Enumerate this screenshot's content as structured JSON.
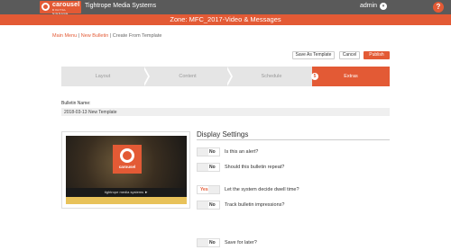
{
  "header": {
    "logo_text": "carousel",
    "logo_sub": "DIGITAL SIGNAGE",
    "org_name": "Tightrope Media Systems",
    "user": "admin",
    "user_caret_icon": "chevron-down-icon",
    "help_icon": "?"
  },
  "zone": {
    "title": "Zone: MFC_2017-Video & Messages"
  },
  "breadcrumb": {
    "main_menu": "Main Menu",
    "sep1": " | ",
    "new_bulletin": "New Bulletin",
    "sep2": " | ",
    "current": "Create From Template"
  },
  "toolbar": {
    "save_template": "Save As Template",
    "cancel": "Cancel",
    "publish": "Publish"
  },
  "steps": [
    {
      "label": "Layout"
    },
    {
      "label": "Content"
    },
    {
      "label": "Schedule"
    },
    {
      "label": "Extras",
      "active": true,
      "number": "5"
    }
  ],
  "bulletin": {
    "name_label": "Bulletin Name:",
    "name_value": "2018-03-13 New Template"
  },
  "preview": {
    "logo_text": "carousel",
    "caption": "tightrope media systems ►"
  },
  "display_settings": {
    "title": "Display Settings",
    "items": [
      {
        "value": "No",
        "question": "Is this an alert?"
      },
      {
        "value": "No",
        "question": "Should this bulletin repeat?"
      },
      {
        "value": "Yes",
        "question": "Let the system decide dwell time?"
      },
      {
        "value": "No",
        "question": "Track bulletin impressions?"
      }
    ]
  },
  "save_later": {
    "value": "No",
    "question": "Save for later?"
  },
  "colors": {
    "accent": "#e35a35",
    "topbar": "#5a5a5a"
  }
}
